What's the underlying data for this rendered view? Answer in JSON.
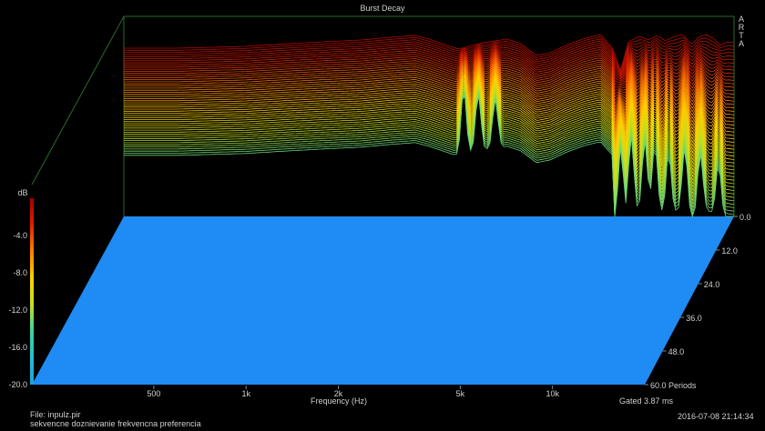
{
  "chart_data": {
    "type": "waterfall-3d",
    "title": "Burst Decay",
    "brand_vertical": "ARTA",
    "xlabel": "Frequency (Hz)",
    "x_tick_labels": [
      "500",
      "1k",
      "2k",
      "5k",
      "10k"
    ],
    "x_tick_values": [
      500,
      1000,
      2000,
      5000,
      10000
    ],
    "xlim": [
      200,
      20000
    ],
    "x_scale": "log",
    "ylabel": "dB",
    "ylim": [
      -20,
      0
    ],
    "y_tick_labels": [
      "-4.0",
      "-8.0",
      "-12.0",
      "-16.0",
      "-20.0"
    ],
    "y_tick_values": [
      -4,
      -8,
      -12,
      -16,
      -20
    ],
    "z_tick_labels": [
      "0.0",
      "12.0",
      "24.0",
      "36.0",
      "48.0",
      "60.0 Periods"
    ],
    "z_tick_values": [
      0,
      12,
      24,
      36,
      48,
      60
    ],
    "zlim": [
      0,
      60
    ],
    "gated_label": "Gated 3.87 ms",
    "file_label": "File: inpulz.pir",
    "description": "sekvencne doznievanie frekvencna  preferencia",
    "datetime": "2016-07-08  21:14:34",
    "colorbar": [
      "#a00000",
      "#e02000",
      "#ff8000",
      "#ffd000",
      "#c0e020",
      "#40d0a0",
      "#20c0d0",
      "#1ea0e0"
    ],
    "floor_color": "#1f8bf4",
    "series": [
      {
        "values": [
          [
            200,
            0
          ],
          [
            300,
            0
          ],
          [
            500,
            0
          ],
          [
            700,
            0
          ],
          [
            900,
            0
          ],
          [
            1200,
            0
          ],
          [
            1500,
            0
          ],
          [
            2000,
            0
          ],
          [
            2500,
            0
          ],
          [
            3000,
            0
          ],
          [
            4000,
            0
          ],
          [
            5000,
            0
          ],
          [
            6000,
            0
          ],
          [
            7000,
            0
          ],
          [
            8000,
            0
          ],
          [
            9000,
            0
          ],
          [
            10000,
            0
          ],
          [
            12000,
            0
          ],
          [
            14000,
            0
          ],
          [
            17000,
            0
          ],
          [
            20000,
            0
          ]
        ]
      }
    ],
    "note_levels": [
      [
        200,
        -1.5
      ],
      [
        300,
        -1.5
      ],
      [
        500,
        -1.3
      ],
      [
        700,
        -1.0
      ],
      [
        900,
        -0.8
      ],
      [
        1200,
        -0.6
      ],
      [
        1500,
        -0.3
      ],
      [
        1800,
        -0.1
      ],
      [
        2000,
        -0.5
      ],
      [
        2500,
        -1.6
      ],
      [
        3000,
        -0.9
      ],
      [
        3600,
        -0.5
      ],
      [
        4000,
        -1.0
      ],
      [
        4500,
        -2.3
      ],
      [
        5000,
        -2.0
      ],
      [
        5600,
        -1.2
      ],
      [
        6500,
        -0.4
      ],
      [
        7300,
        0.0
      ],
      [
        8000,
        -1.5
      ],
      [
        8500,
        -4.0
      ],
      [
        9000,
        -0.8
      ],
      [
        9800,
        -0.2
      ],
      [
        10500,
        -0.6
      ],
      [
        11200,
        -0.1
      ],
      [
        11900,
        -0.7
      ],
      [
        12800,
        -0.2
      ],
      [
        13600,
        0.0
      ],
      [
        14500,
        -1.1
      ],
      [
        15300,
        -0.3
      ],
      [
        16200,
        0.0
      ],
      [
        17200,
        -0.5
      ],
      [
        18000,
        -1.2
      ],
      [
        19000,
        -0.8
      ],
      [
        20000,
        -0.9
      ]
    ]
  }
}
